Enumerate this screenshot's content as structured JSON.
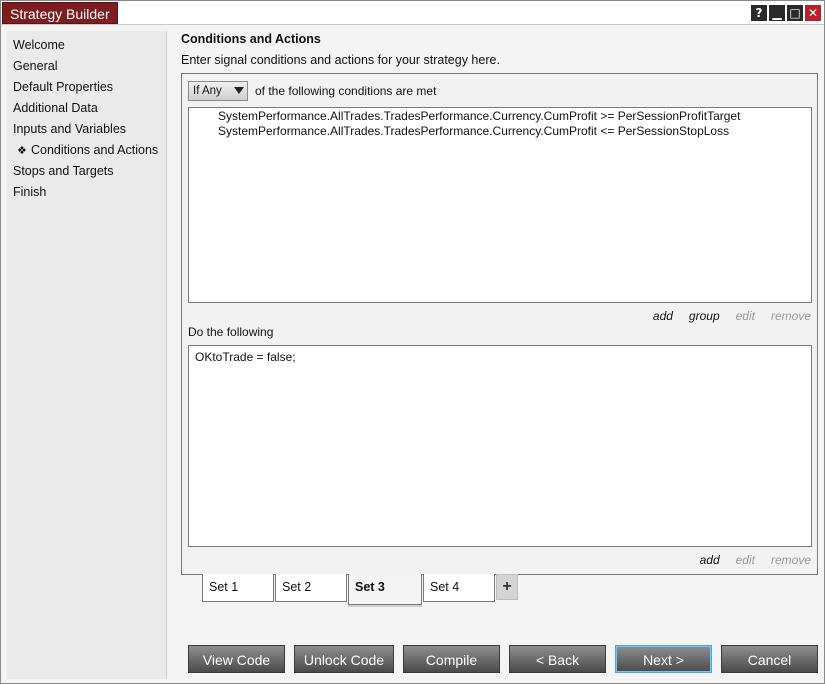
{
  "window": {
    "title": "Strategy Builder"
  },
  "window_controls": {
    "help": "?",
    "minimize": "▁",
    "maximize": "□",
    "close": "✕"
  },
  "sidebar": {
    "items": [
      {
        "label": "Welcome"
      },
      {
        "label": "General"
      },
      {
        "label": "Default Properties"
      },
      {
        "label": "Additional Data"
      },
      {
        "label": "Inputs and Variables"
      },
      {
        "label": "Conditions and Actions",
        "bullet": "❖",
        "active": true
      },
      {
        "label": "Stops and Targets"
      },
      {
        "label": "Finish"
      }
    ]
  },
  "main": {
    "heading": "Conditions and Actions",
    "subheading": "Enter signal conditions and actions for your strategy here.",
    "condition_mode": {
      "selected": "If Any",
      "suffix": "of the following conditions are met"
    },
    "conditions": [
      "SystemPerformance.AllTrades.TradesPerformance.Currency.CumProfit >= PerSessionProfitTarget",
      "SystemPerformance.AllTrades.TradesPerformance.Currency.CumProfit <= PerSessionStopLoss"
    ],
    "condition_links": {
      "add": "add",
      "group": "group",
      "edit": "edit",
      "remove": "remove"
    },
    "actions_label": "Do the following",
    "actions": [
      "OKtoTrade = false;"
    ],
    "action_links": {
      "add": "add",
      "edit": "edit",
      "remove": "remove"
    }
  },
  "sets": {
    "tabs": [
      "Set 1",
      "Set 2",
      "Set 3",
      "Set 4"
    ],
    "selected": "Set 3",
    "add_label": "+"
  },
  "footer": {
    "view_code": "View Code",
    "unlock_code": "Unlock Code",
    "compile": "Compile",
    "back": "< Back",
    "next": "Next >",
    "cancel": "Cancel"
  },
  "colors": {
    "title_bg": "#7d1d22",
    "button_bg": "#5e5e5e",
    "focus_border": "#4aa7e0"
  }
}
